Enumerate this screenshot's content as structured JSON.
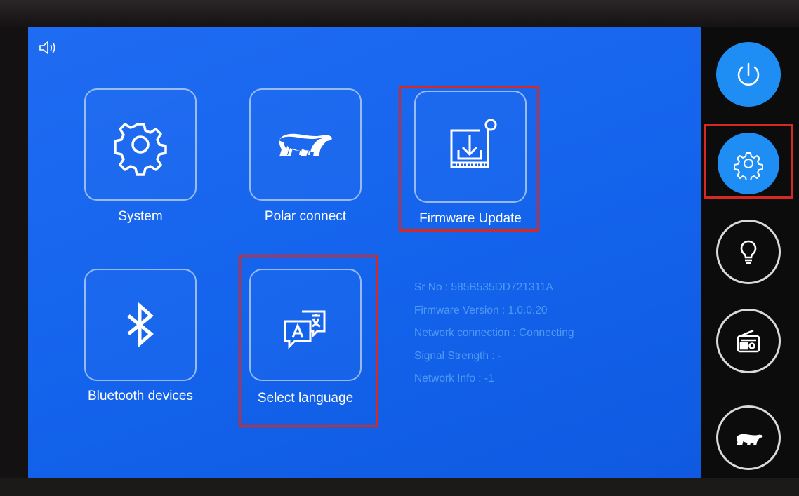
{
  "tiles": [
    {
      "label": "System",
      "icon": "gear-icon"
    },
    {
      "label": "Polar connect",
      "icon": "polar-bear-icon"
    },
    {
      "label": "Firmware Update",
      "icon": "firmware-download-icon"
    },
    {
      "label": "Bluetooth devices",
      "icon": "bluetooth-icon"
    },
    {
      "label": "Select language",
      "icon": "translate-icon"
    }
  ],
  "info": {
    "serial": "Sr No : 585B535DD721311A",
    "firmware": "Firmware Version : 1.0.0.20",
    "network": "Network connection : Connecting",
    "signal": "Signal Strength : -",
    "netinfo": "Network Info :   -1"
  },
  "rail": [
    "power-icon",
    "settings-gear-icon",
    "lightbulb-icon",
    "radio-icon",
    "polar-bear-icon"
  ],
  "colors": {
    "screen": "#1463ec",
    "highlight": "#d42a24",
    "rail_button": "#1e8ef5"
  }
}
